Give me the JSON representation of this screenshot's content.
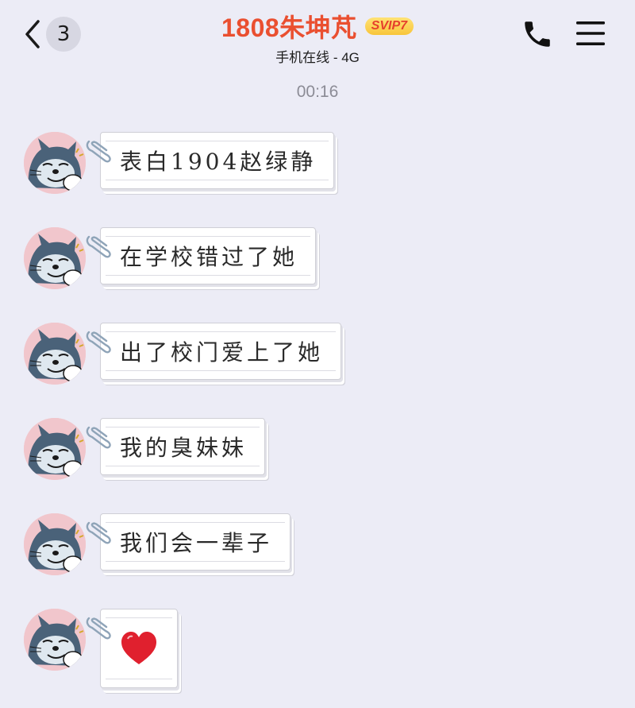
{
  "header": {
    "back_icon": "chevron-left-icon",
    "unread_count": "3",
    "contact_name": "1808朱坤芃",
    "vip_badge": "SVIP7",
    "status": "手机在线 - 4G",
    "call_icon": "phone-icon",
    "menu_icon": "hamburger-menu-icon"
  },
  "chat": {
    "timestamp": "00:16",
    "messages": [
      {
        "sender": "contact",
        "text": "表白1904赵绿静"
      },
      {
        "sender": "contact",
        "text": "在学校错过了她"
      },
      {
        "sender": "contact",
        "text": "出了校门爱上了她"
      },
      {
        "sender": "contact",
        "text": "我的臭妹妹"
      },
      {
        "sender": "contact",
        "text": "我们会一辈子"
      },
      {
        "sender": "contact",
        "emoji": "red-heart-icon"
      }
    ]
  },
  "colors": {
    "background": "#ececf6",
    "contact_name": "#ea4f30",
    "vip_badge": "#f8c53a",
    "timestamp": "#8c8c96",
    "heart": "#e0202e"
  }
}
